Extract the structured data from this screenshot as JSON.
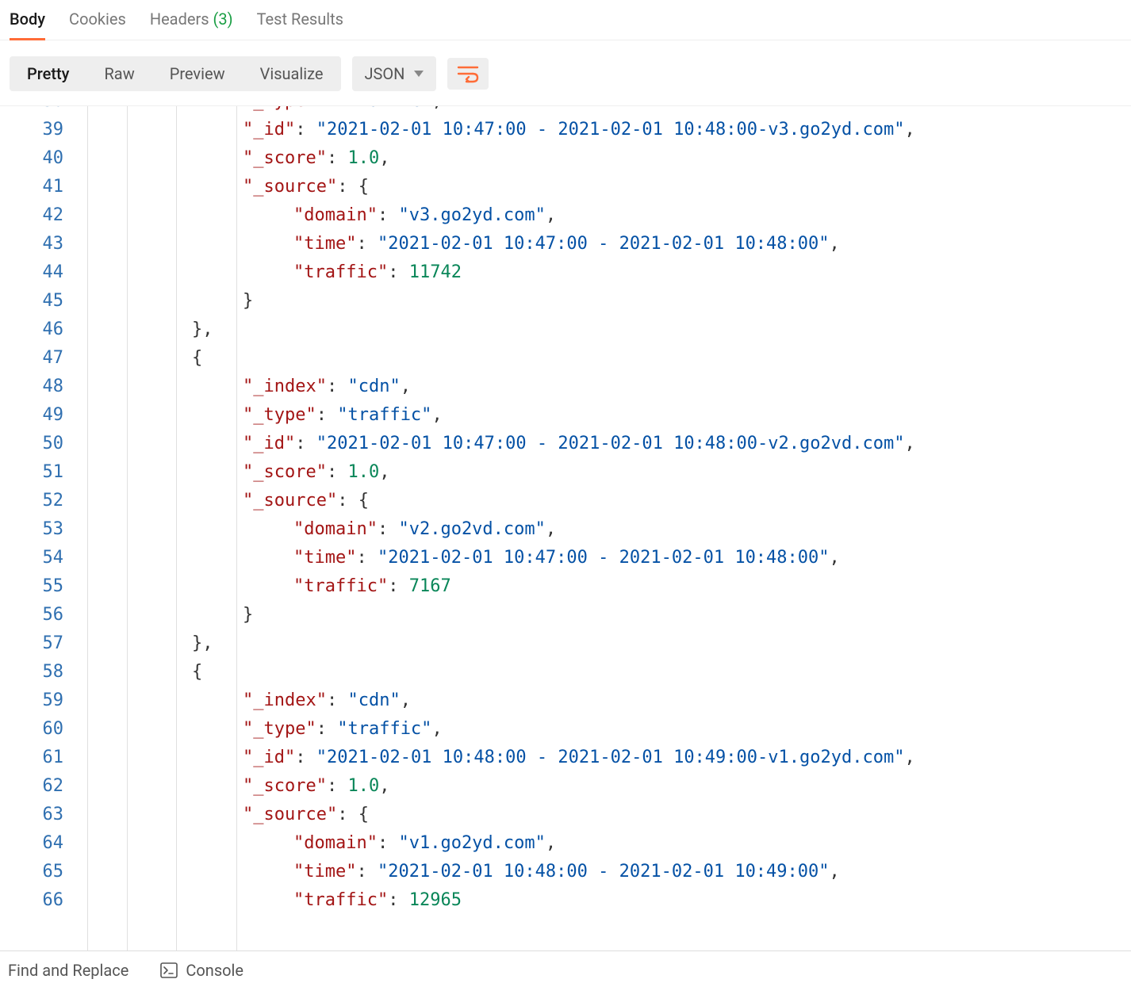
{
  "tabs": {
    "body": "Body",
    "cookies": "Cookies",
    "headers": "Headers",
    "headers_count": "(3)",
    "test_results": "Test Results"
  },
  "toolbar": {
    "pretty": "Pretty",
    "raw": "Raw",
    "preview": "Preview",
    "visualize": "Visualize",
    "format": "JSON"
  },
  "lines_start": 38,
  "lines": [
    {
      "indent": 3,
      "tokens": [
        [
          "k",
          "\"_type\""
        ],
        [
          "p",
          ": "
        ],
        [
          "s",
          "\"traffic\""
        ],
        [
          "p",
          ","
        ]
      ]
    },
    {
      "indent": 3,
      "tokens": [
        [
          "k",
          "\"_id\""
        ],
        [
          "p",
          ": "
        ],
        [
          "s",
          "\"2021-02-01 10:47:00 - 2021-02-01 10:48:00-v3.go2yd.com\""
        ],
        [
          "p",
          ","
        ]
      ]
    },
    {
      "indent": 3,
      "tokens": [
        [
          "k",
          "\"_score\""
        ],
        [
          "p",
          ": "
        ],
        [
          "n",
          "1.0"
        ],
        [
          "p",
          ","
        ]
      ]
    },
    {
      "indent": 3,
      "tokens": [
        [
          "k",
          "\"_source\""
        ],
        [
          "p",
          ": "
        ],
        [
          "p",
          "{"
        ]
      ]
    },
    {
      "indent": 4,
      "tokens": [
        [
          "k",
          "\"domain\""
        ],
        [
          "p",
          ": "
        ],
        [
          "s",
          "\"v3.go2yd.com\""
        ],
        [
          "p",
          ","
        ]
      ]
    },
    {
      "indent": 4,
      "tokens": [
        [
          "k",
          "\"time\""
        ],
        [
          "p",
          ": "
        ],
        [
          "s",
          "\"2021-02-01 10:47:00 - 2021-02-01 10:48:00\""
        ],
        [
          "p",
          ","
        ]
      ]
    },
    {
      "indent": 4,
      "tokens": [
        [
          "k",
          "\"traffic\""
        ],
        [
          "p",
          ": "
        ],
        [
          "n",
          "11742"
        ]
      ]
    },
    {
      "indent": 3,
      "tokens": [
        [
          "p",
          "}"
        ]
      ]
    },
    {
      "indent": 2,
      "tokens": [
        [
          "p",
          "},"
        ]
      ]
    },
    {
      "indent": 2,
      "tokens": [
        [
          "p",
          "{"
        ]
      ]
    },
    {
      "indent": 3,
      "tokens": [
        [
          "k",
          "\"_index\""
        ],
        [
          "p",
          ": "
        ],
        [
          "s",
          "\"cdn\""
        ],
        [
          "p",
          ","
        ]
      ]
    },
    {
      "indent": 3,
      "tokens": [
        [
          "k",
          "\"_type\""
        ],
        [
          "p",
          ": "
        ],
        [
          "s",
          "\"traffic\""
        ],
        [
          "p",
          ","
        ]
      ]
    },
    {
      "indent": 3,
      "tokens": [
        [
          "k",
          "\"_id\""
        ],
        [
          "p",
          ": "
        ],
        [
          "s",
          "\"2021-02-01 10:47:00 - 2021-02-01 10:48:00-v2.go2vd.com\""
        ],
        [
          "p",
          ","
        ]
      ]
    },
    {
      "indent": 3,
      "tokens": [
        [
          "k",
          "\"_score\""
        ],
        [
          "p",
          ": "
        ],
        [
          "n",
          "1.0"
        ],
        [
          "p",
          ","
        ]
      ]
    },
    {
      "indent": 3,
      "tokens": [
        [
          "k",
          "\"_source\""
        ],
        [
          "p",
          ": "
        ],
        [
          "p",
          "{"
        ]
      ]
    },
    {
      "indent": 4,
      "tokens": [
        [
          "k",
          "\"domain\""
        ],
        [
          "p",
          ": "
        ],
        [
          "s",
          "\"v2.go2vd.com\""
        ],
        [
          "p",
          ","
        ]
      ]
    },
    {
      "indent": 4,
      "tokens": [
        [
          "k",
          "\"time\""
        ],
        [
          "p",
          ": "
        ],
        [
          "s",
          "\"2021-02-01 10:47:00 - 2021-02-01 10:48:00\""
        ],
        [
          "p",
          ","
        ]
      ]
    },
    {
      "indent": 4,
      "tokens": [
        [
          "k",
          "\"traffic\""
        ],
        [
          "p",
          ": "
        ],
        [
          "n",
          "7167"
        ]
      ]
    },
    {
      "indent": 3,
      "tokens": [
        [
          "p",
          "}"
        ]
      ]
    },
    {
      "indent": 2,
      "tokens": [
        [
          "p",
          "},"
        ]
      ]
    },
    {
      "indent": 2,
      "tokens": [
        [
          "p",
          "{"
        ]
      ]
    },
    {
      "indent": 3,
      "tokens": [
        [
          "k",
          "\"_index\""
        ],
        [
          "p",
          ": "
        ],
        [
          "s",
          "\"cdn\""
        ],
        [
          "p",
          ","
        ]
      ]
    },
    {
      "indent": 3,
      "tokens": [
        [
          "k",
          "\"_type\""
        ],
        [
          "p",
          ": "
        ],
        [
          "s",
          "\"traffic\""
        ],
        [
          "p",
          ","
        ]
      ]
    },
    {
      "indent": 3,
      "tokens": [
        [
          "k",
          "\"_id\""
        ],
        [
          "p",
          ": "
        ],
        [
          "s",
          "\"2021-02-01 10:48:00 - 2021-02-01 10:49:00-v1.go2yd.com\""
        ],
        [
          "p",
          ","
        ]
      ]
    },
    {
      "indent": 3,
      "tokens": [
        [
          "k",
          "\"_score\""
        ],
        [
          "p",
          ": "
        ],
        [
          "n",
          "1.0"
        ],
        [
          "p",
          ","
        ]
      ]
    },
    {
      "indent": 3,
      "tokens": [
        [
          "k",
          "\"_source\""
        ],
        [
          "p",
          ": "
        ],
        [
          "p",
          "{"
        ]
      ]
    },
    {
      "indent": 4,
      "tokens": [
        [
          "k",
          "\"domain\""
        ],
        [
          "p",
          ": "
        ],
        [
          "s",
          "\"v1.go2yd.com\""
        ],
        [
          "p",
          ","
        ]
      ]
    },
    {
      "indent": 4,
      "tokens": [
        [
          "k",
          "\"time\""
        ],
        [
          "p",
          ": "
        ],
        [
          "s",
          "\"2021-02-01 10:48:00 - 2021-02-01 10:49:00\""
        ],
        [
          "p",
          ","
        ]
      ]
    },
    {
      "indent": 4,
      "tokens": [
        [
          "k",
          "\"traffic\""
        ],
        [
          "p",
          ": "
        ],
        [
          "n",
          "12965"
        ]
      ]
    }
  ],
  "bottom": {
    "find_replace": "Find and Replace",
    "console": "Console"
  }
}
